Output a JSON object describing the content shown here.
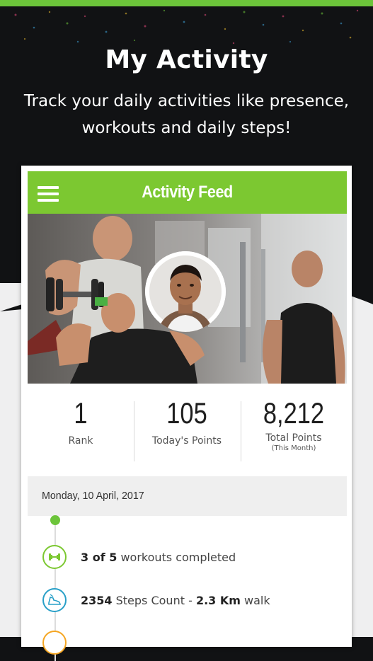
{
  "promo": {
    "title": "My Activity",
    "subtitle_line1": "Track your daily activities like presence,",
    "subtitle_line2": "workouts and daily steps!"
  },
  "app": {
    "header_title": "Activity Feed",
    "menu_icon": "hamburger-menu-icon"
  },
  "stats": [
    {
      "value": "1",
      "label": "Rank",
      "sub": ""
    },
    {
      "value": "105",
      "label": "Today's Points",
      "sub": ""
    },
    {
      "value": "8,212",
      "label": "Total Points",
      "sub": "(This Month)"
    }
  ],
  "feed": {
    "date": "Monday, 10 April, 2017",
    "items": [
      {
        "icon": "dumbbell-icon",
        "bold1": "3 of 5",
        "text1": " workouts completed",
        "bold2": "",
        "text2": ""
      },
      {
        "icon": "shoe-icon",
        "bold1": "2354",
        "text1": " Steps Count - ",
        "bold2": "2.3 Km",
        "text2": " walk"
      }
    ]
  },
  "colors": {
    "accent": "#7cc831",
    "top_bar": "#6cc43a",
    "background_dark": "#111214",
    "steps_icon": "#29a0c8",
    "next_icon": "#f5a623"
  }
}
